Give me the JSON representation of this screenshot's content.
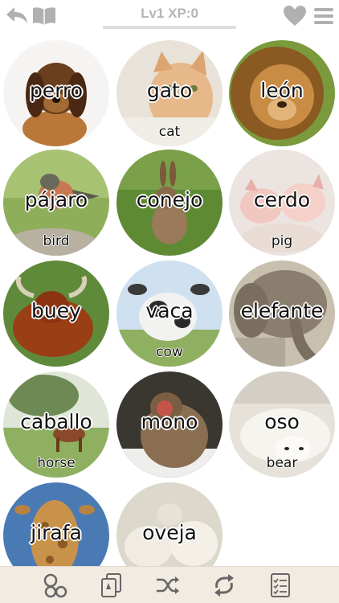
{
  "header": {
    "level_label": "Lv1 XP:0",
    "xp_progress": 0
  },
  "icons": {
    "back": "back-arrow-icon",
    "book": "book-icon",
    "heart": "heart-icon",
    "menu": "menu-icon"
  },
  "cards": [
    {
      "word": "perro",
      "translation": ""
    },
    {
      "word": "gato",
      "translation": "cat"
    },
    {
      "word": "león",
      "translation": ""
    },
    {
      "word": "pájaro",
      "translation": "bird"
    },
    {
      "word": "conejo",
      "translation": ""
    },
    {
      "word": "cerdo",
      "translation": "pig"
    },
    {
      "word": "buey",
      "translation": ""
    },
    {
      "word": "vaca",
      "translation": "cow"
    },
    {
      "word": "elefante",
      "translation": ""
    },
    {
      "word": "caballo",
      "translation": "horse"
    },
    {
      "word": "mono",
      "translation": ""
    },
    {
      "word": "oso",
      "translation": "bear"
    },
    {
      "word": "jirafa",
      "translation": ""
    },
    {
      "word": "oveja",
      "translation": ""
    }
  ],
  "bottom_nav": [
    "circles-icon",
    "flashcards-icon",
    "shuffle-icon",
    "repeat-icon",
    "checklist-icon"
  ]
}
